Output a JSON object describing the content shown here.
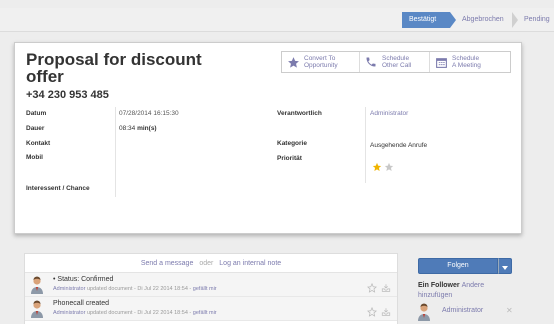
{
  "statusbar": {
    "stages": [
      "Bestätigt",
      "Abgebrochen",
      "Pending"
    ]
  },
  "record": {
    "title": "Proposal for discount offer",
    "phone": "+34 230 953 485"
  },
  "buttons": {
    "convert": "Convert To\nOpportunity",
    "schedule_call": "Schedule\nOther Call",
    "schedule_meeting": "Schedule\nA Meeting"
  },
  "fields": {
    "datum_label": "Datum",
    "datum_value": "07/28/2014 16:15:30",
    "dauer_label": "Dauer",
    "dauer_value": "08:34",
    "dauer_unit": "min(s)",
    "kontakt_label": "Kontakt",
    "mobil_label": "Mobil",
    "interessent_label": "Interessent / Chance",
    "verantwortlich_label": "Verantwortlich",
    "verantwortlich_value": "Administrator",
    "kategorie_label": "Kategorie",
    "kategorie_value": "Ausgehende Anrufe",
    "prioritaet_label": "Priorität",
    "priority_stars": 1,
    "priority_max": 2
  },
  "chatter": {
    "send_message": "Send a message",
    "or": "oder",
    "log_note": "Log an internal note",
    "messages": [
      {
        "title": "• Status: Confirmed",
        "author": "Administrator",
        "action": "updated document",
        "date": "Di Jul 22 2014 18:54",
        "like": "gefällt mir"
      },
      {
        "title": "Phonecall created",
        "author": "Administrator",
        "action": "updated document",
        "date": "Di Jul 22 2014 18:54",
        "like": "gefällt mir"
      }
    ]
  },
  "followers": {
    "follow_button": "Folgen",
    "heading": "Ein Follower",
    "others": "Andere",
    "add": "hinzufügen",
    "items": [
      {
        "name": "Administrator"
      }
    ]
  },
  "colors": {
    "accent": "#5a88c5",
    "link": "#7c7bad",
    "star": "#f0b400"
  }
}
